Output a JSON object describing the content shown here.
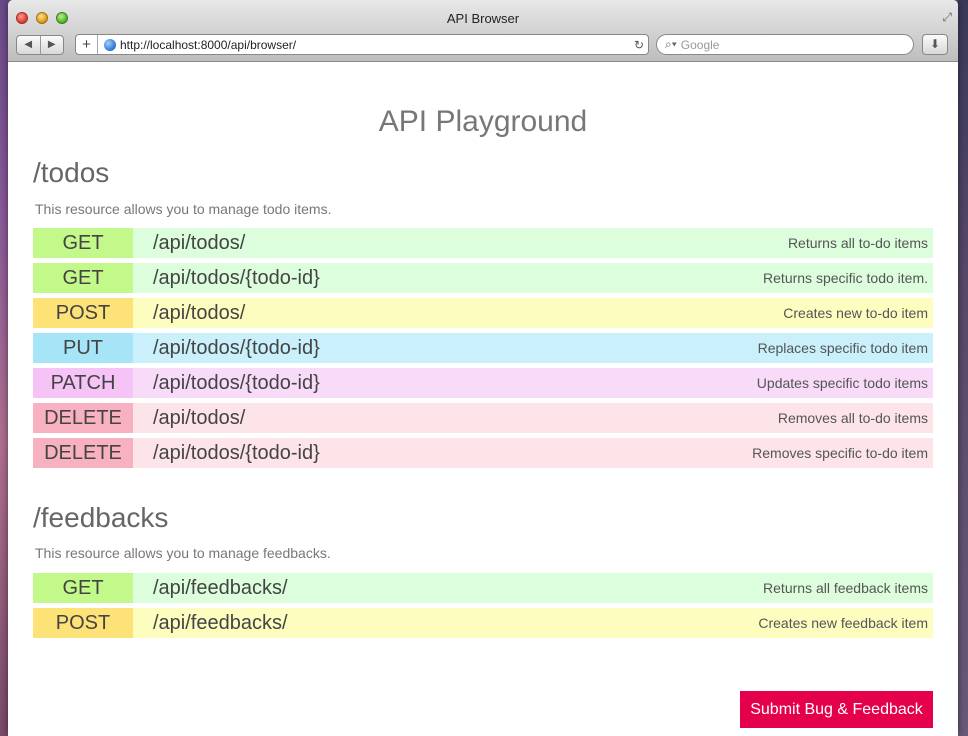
{
  "window": {
    "title": "API Browser",
    "url": "http://localhost:8000/api/browser/",
    "search_placeholder": "Google"
  },
  "page": {
    "title": "API Playground",
    "submit_label": "Submit Bug & Feedback"
  },
  "sections": [
    {
      "title": "/todos",
      "description": "This resource allows you to manage todo items.",
      "endpoints": [
        {
          "method": "GET",
          "path": "/api/todos/",
          "summary": "Returns all to-do items"
        },
        {
          "method": "GET",
          "path": "/api/todos/{todo-id}",
          "summary": "Returns specific todo item."
        },
        {
          "method": "POST",
          "path": "/api/todos/",
          "summary": "Creates new to-do item"
        },
        {
          "method": "PUT",
          "path": "/api/todos/{todo-id}",
          "summary": "Replaces specific todo item"
        },
        {
          "method": "PATCH",
          "path": "/api/todos/{todo-id}",
          "summary": "Updates specific todo items"
        },
        {
          "method": "DELETE",
          "path": "/api/todos/",
          "summary": "Removes all to-do items"
        },
        {
          "method": "DELETE",
          "path": "/api/todos/{todo-id}",
          "summary": "Removes specific to-do item"
        }
      ]
    },
    {
      "title": "/feedbacks",
      "description": "This resource allows you to manage feedbacks.",
      "endpoints": [
        {
          "method": "GET",
          "path": "/api/feedbacks/",
          "summary": "Returns all feedback items"
        },
        {
          "method": "POST",
          "path": "/api/feedbacks/",
          "summary": "Creates new feedback item"
        }
      ]
    }
  ],
  "colors": {
    "get": "#c3f98b",
    "post": "#fde277",
    "put": "#a6e5f8",
    "patch": "#f6c3f6",
    "delete": "#f8b1c1",
    "submit": "#e5004b"
  }
}
